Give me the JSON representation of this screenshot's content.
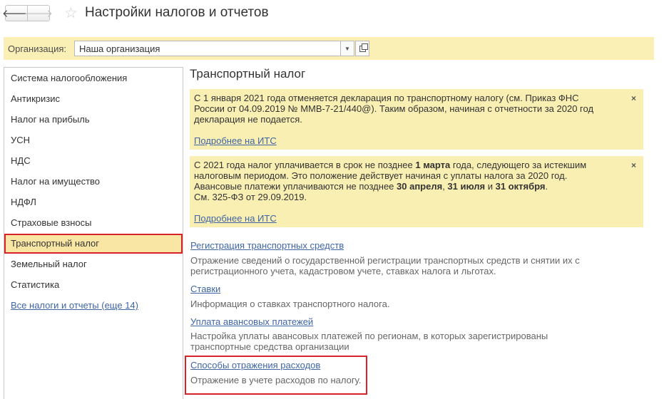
{
  "header": {
    "back_icon": "arrow-left-icon",
    "forward_icon": "arrow-right-icon",
    "star_icon": "star-outline-icon",
    "title": "Настройки налогов и отчетов"
  },
  "organization": {
    "label": "Организация:",
    "value": "Наша организация"
  },
  "sidebar": {
    "items": [
      {
        "label": "Система налогообложения"
      },
      {
        "label": "Антикризис"
      },
      {
        "label": "Налог на прибыль"
      },
      {
        "label": "УСН"
      },
      {
        "label": "НДС"
      },
      {
        "label": "Налог на имущество"
      },
      {
        "label": "НДФЛ"
      },
      {
        "label": "Страховые взносы"
      },
      {
        "label": "Транспортный налог",
        "active": true
      },
      {
        "label": "Земельный налог"
      },
      {
        "label": "Статистика"
      }
    ],
    "all_link": "Все налоги и отчеты (еще 14)"
  },
  "main": {
    "title": "Транспортный налог",
    "notice1": {
      "line1": "С 1 января 2021 года отменяется декларация по транспортному налогу (см. Приказ ФНС",
      "line2": "России от 04.09.2019 № ММВ-7-21/440@). Таким образом, начиная с отчетности за 2020 год",
      "line3": "декларация не подается.",
      "link": "Подробнее на ИТС",
      "close": "×"
    },
    "notice2": {
      "l1a": "С 2021 года налог уплачивается в срок не позднее ",
      "l1b": "1 марта",
      "l1c": " года, следующего за истекшим",
      "line2": "налоговым периодом. Это положение действует начиная с уплаты налога за 2020 год.",
      "l3a": "Авансовые платежи уплачиваются не позднее ",
      "l3b": "30 апреля",
      "l3c": ", ",
      "l3d": "31 июля",
      "l3e": " и ",
      "l3f": "31 октября",
      "l3g": ".",
      "line4": "См. 325-ФЗ от 29.09.2019.",
      "link": "Подробнее на ИТС",
      "close": "×"
    },
    "links": [
      {
        "title": "Регистрация транспортных средств",
        "desc1": "Отражение сведений о государственной регистрации транспортных средств и снятии их с",
        "desc2": "регистрационного учета, кадастровом учете, ставках налога и льготах."
      },
      {
        "title": "Ставки",
        "desc1": "Информация о ставках транспортного налога.",
        "desc2": ""
      },
      {
        "title": "Уплата авансовых платежей",
        "desc1": "Настройка уплаты авансовых платежей по регионам, в которых зарегистрированы",
        "desc2": "транспортные средства организации"
      },
      {
        "title": "Способы отражения расходов",
        "desc1": "Отражение в учете расходов по налогу.",
        "desc2": ""
      }
    ]
  },
  "colors": {
    "accent_yellow": "#faefb3",
    "link_blue": "#3f65a6",
    "highlight_red": "#d7242b"
  }
}
